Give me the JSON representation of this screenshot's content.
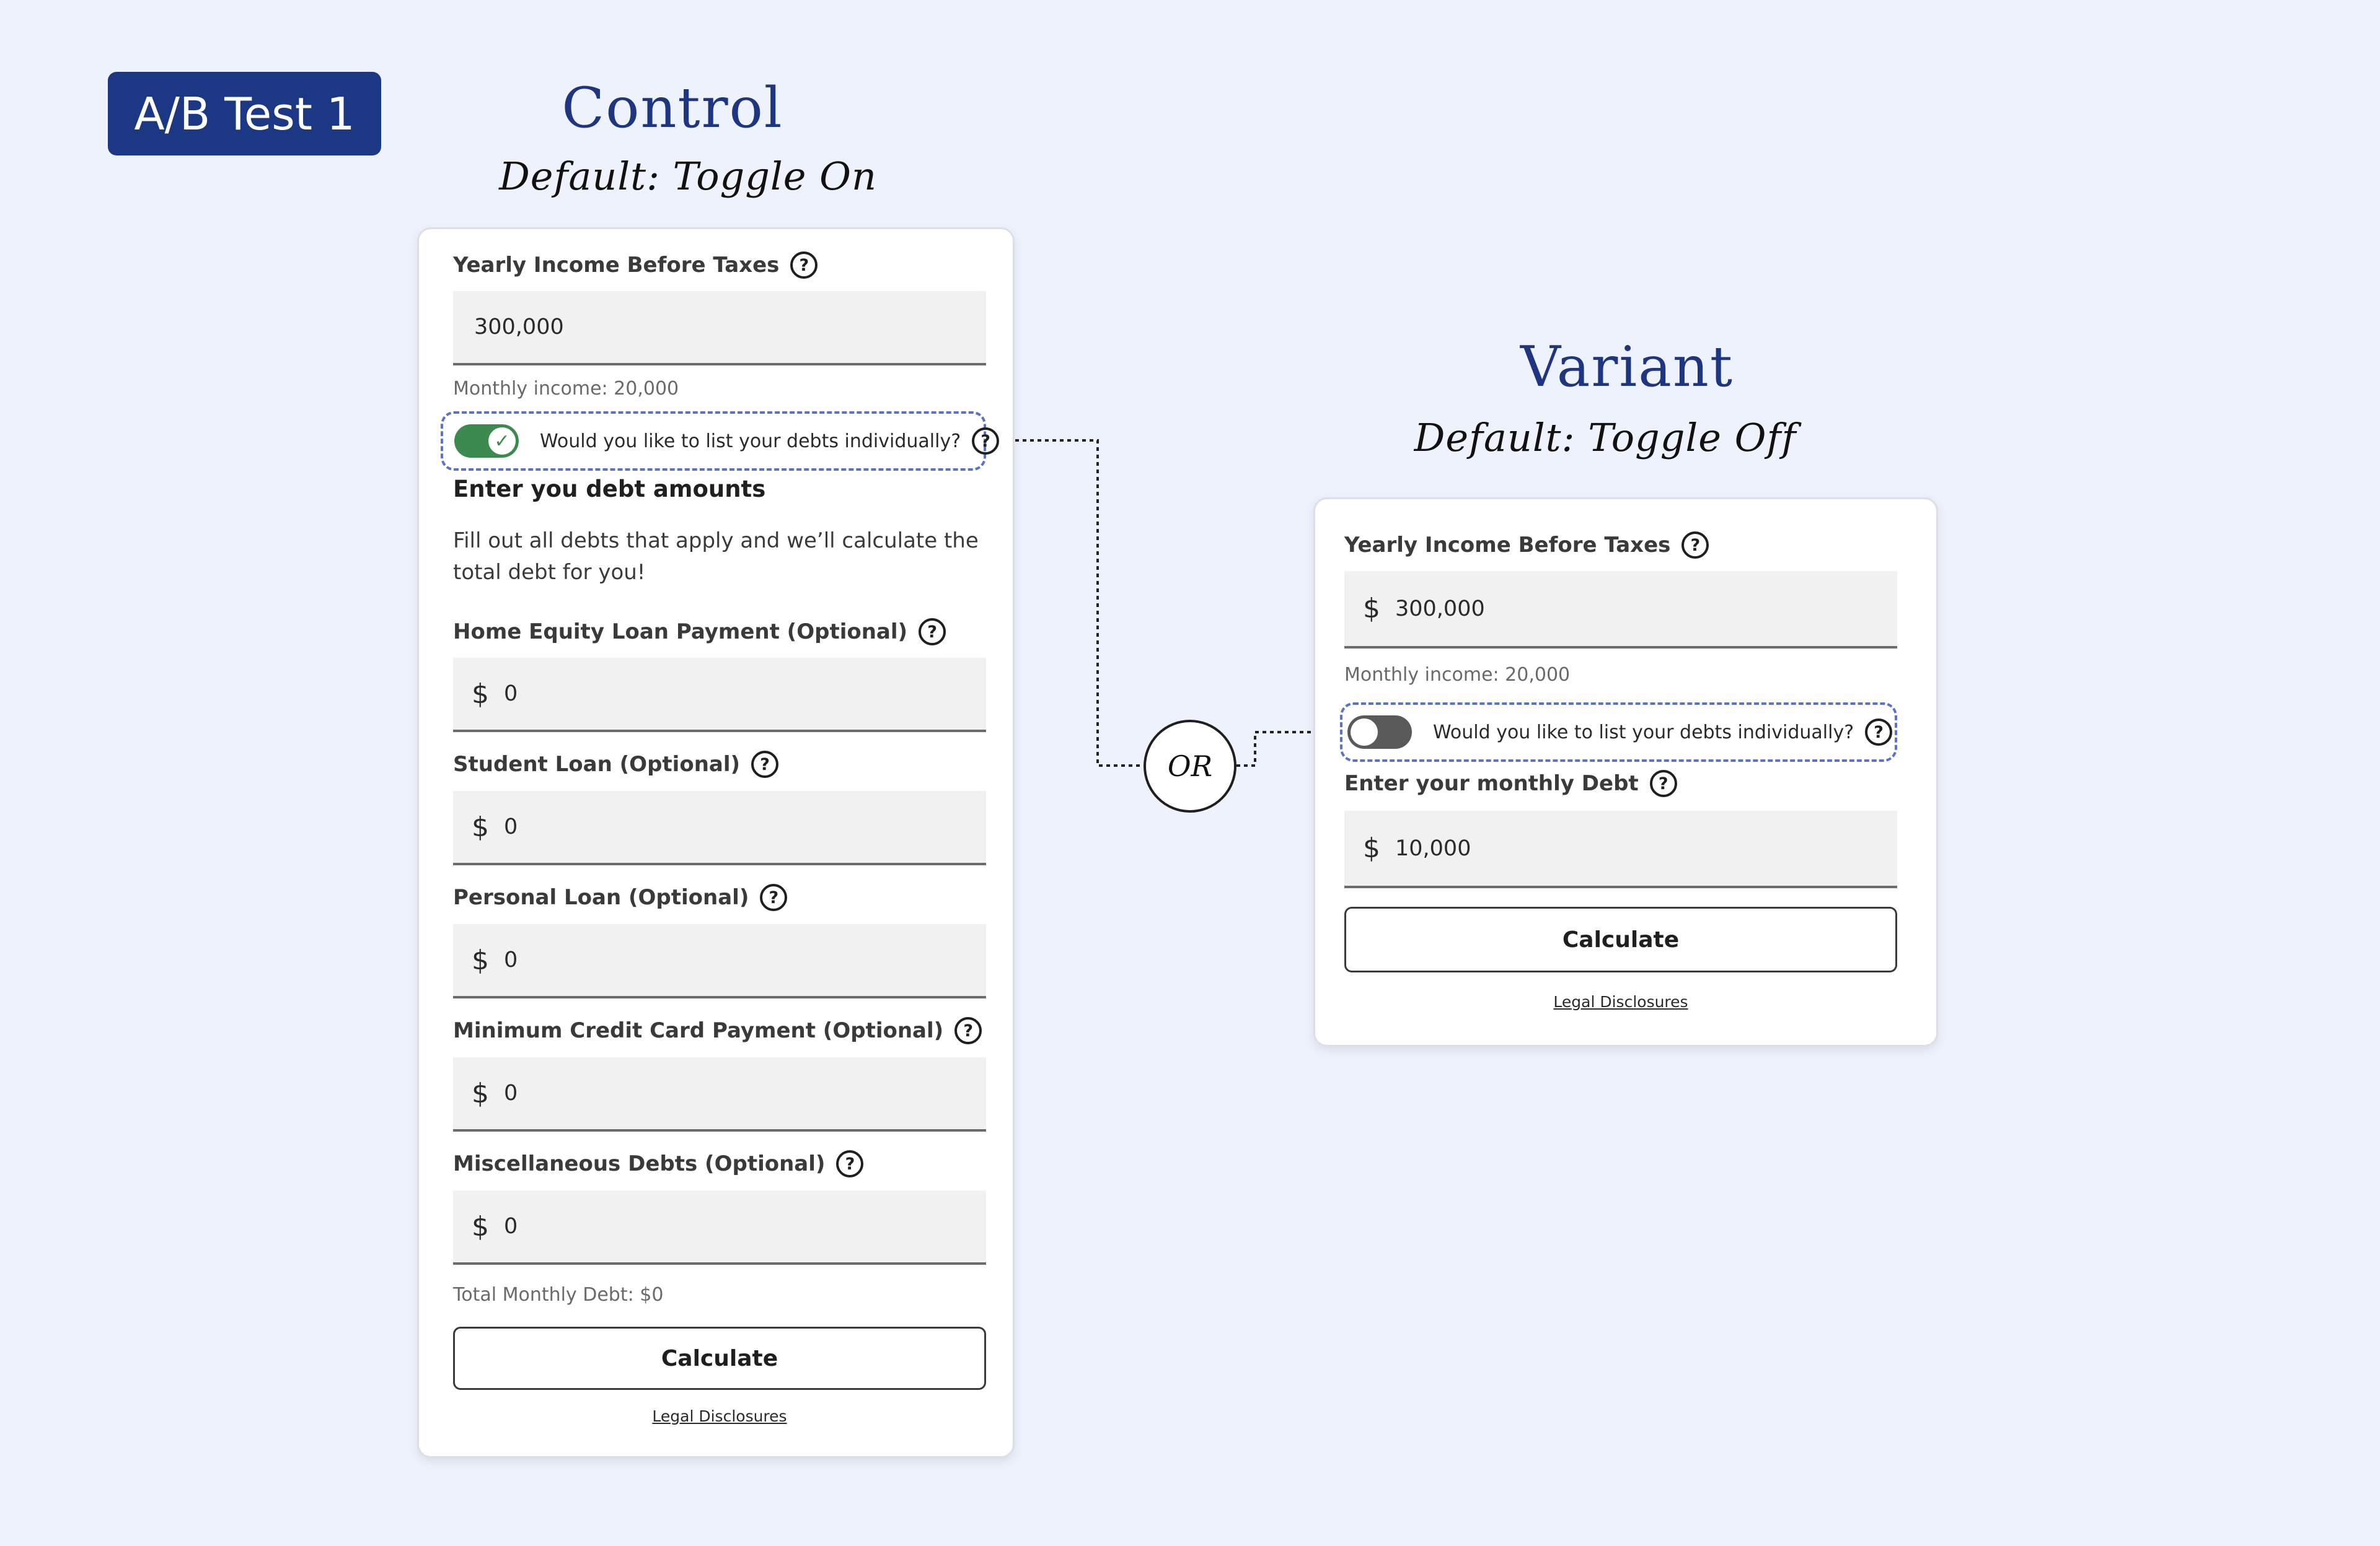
{
  "badge": "A/B Test 1",
  "control": {
    "title": "Control",
    "subtitle": "Default: Toggle On",
    "income_label": "Yearly Income Before Taxes",
    "income_value": "300,000",
    "monthly_income": "Monthly income: 20,000",
    "toggle_text": "Would you like to list your debts individually?",
    "toggle_state": "on",
    "section_title": "Enter you debt amounts",
    "description": "Fill out all debts that apply and we’ll calculate the total debt for you!",
    "debts": [
      {
        "label": "Home Equity Loan Payment (Optional)",
        "value": "0"
      },
      {
        "label": "Student Loan (Optional)",
        "value": "0"
      },
      {
        "label": "Personal Loan (Optional)",
        "value": "0"
      },
      {
        "label": "Minimum Credit Card Payment (Optional)",
        "value": "0"
      },
      {
        "label": "Miscellaneous Debts (Optional)",
        "value": "0"
      }
    ],
    "total": "Total Monthly Debt: $0",
    "button": "Calculate",
    "legal": "Legal Disclosures"
  },
  "or_label": "OR",
  "variant": {
    "title": "Variant",
    "subtitle": "Default: Toggle Off",
    "income_label": "Yearly Income Before Taxes",
    "currency": "$",
    "income_value": "300,000",
    "monthly_income": "Monthly income: 20,000",
    "toggle_text": "Would you like to list your debts individually?",
    "toggle_state": "off",
    "debt_label": "Enter your monthly Debt",
    "debt_value": "10,000",
    "button": "Calculate",
    "legal": "Legal Disclosures"
  },
  "icons": {
    "help": "?",
    "check": "✓",
    "currency": "$"
  },
  "colors": {
    "background": "#eef2fc",
    "badge": "#1c3784",
    "heading": "#1e3682",
    "toggle_on": "#3d8a50",
    "toggle_off": "#5a5a5a",
    "dashed_outline": "#5a73c9"
  }
}
